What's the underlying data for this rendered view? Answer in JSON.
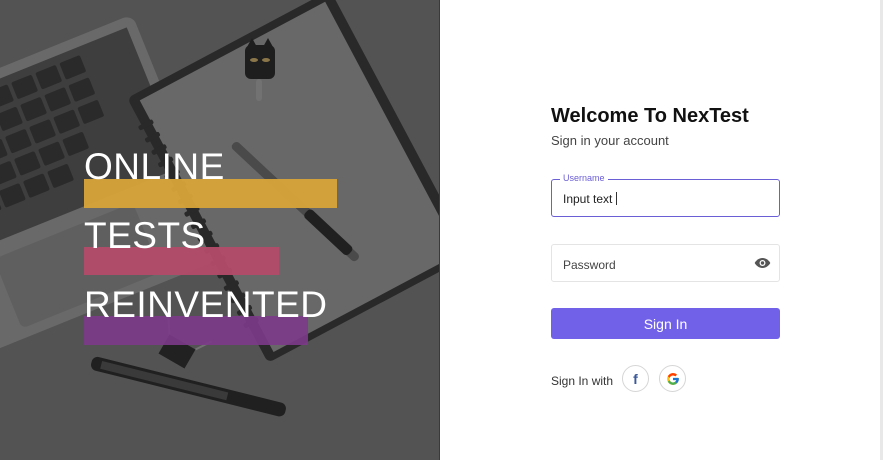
{
  "hero": {
    "words": [
      "ONLINE",
      "TESTS",
      "REINVENTED"
    ],
    "bar_colors": [
      "#d8a43a",
      "#b24b6a",
      "#7b3a89"
    ]
  },
  "login": {
    "title": "Welcome To NexTest",
    "subtitle": "Sign in your account",
    "username": {
      "legend": "Username",
      "value": "Input text"
    },
    "password": {
      "placeholder": "Password",
      "toggle_icon": "eye-icon"
    },
    "submit_label": "Sign In",
    "social": {
      "label": "Sign In with",
      "providers": [
        {
          "name": "facebook",
          "icon": "facebook-icon",
          "color": "#3b5998"
        },
        {
          "name": "google",
          "icon": "google-icon"
        }
      ]
    },
    "accent_color": "#7061e8"
  }
}
